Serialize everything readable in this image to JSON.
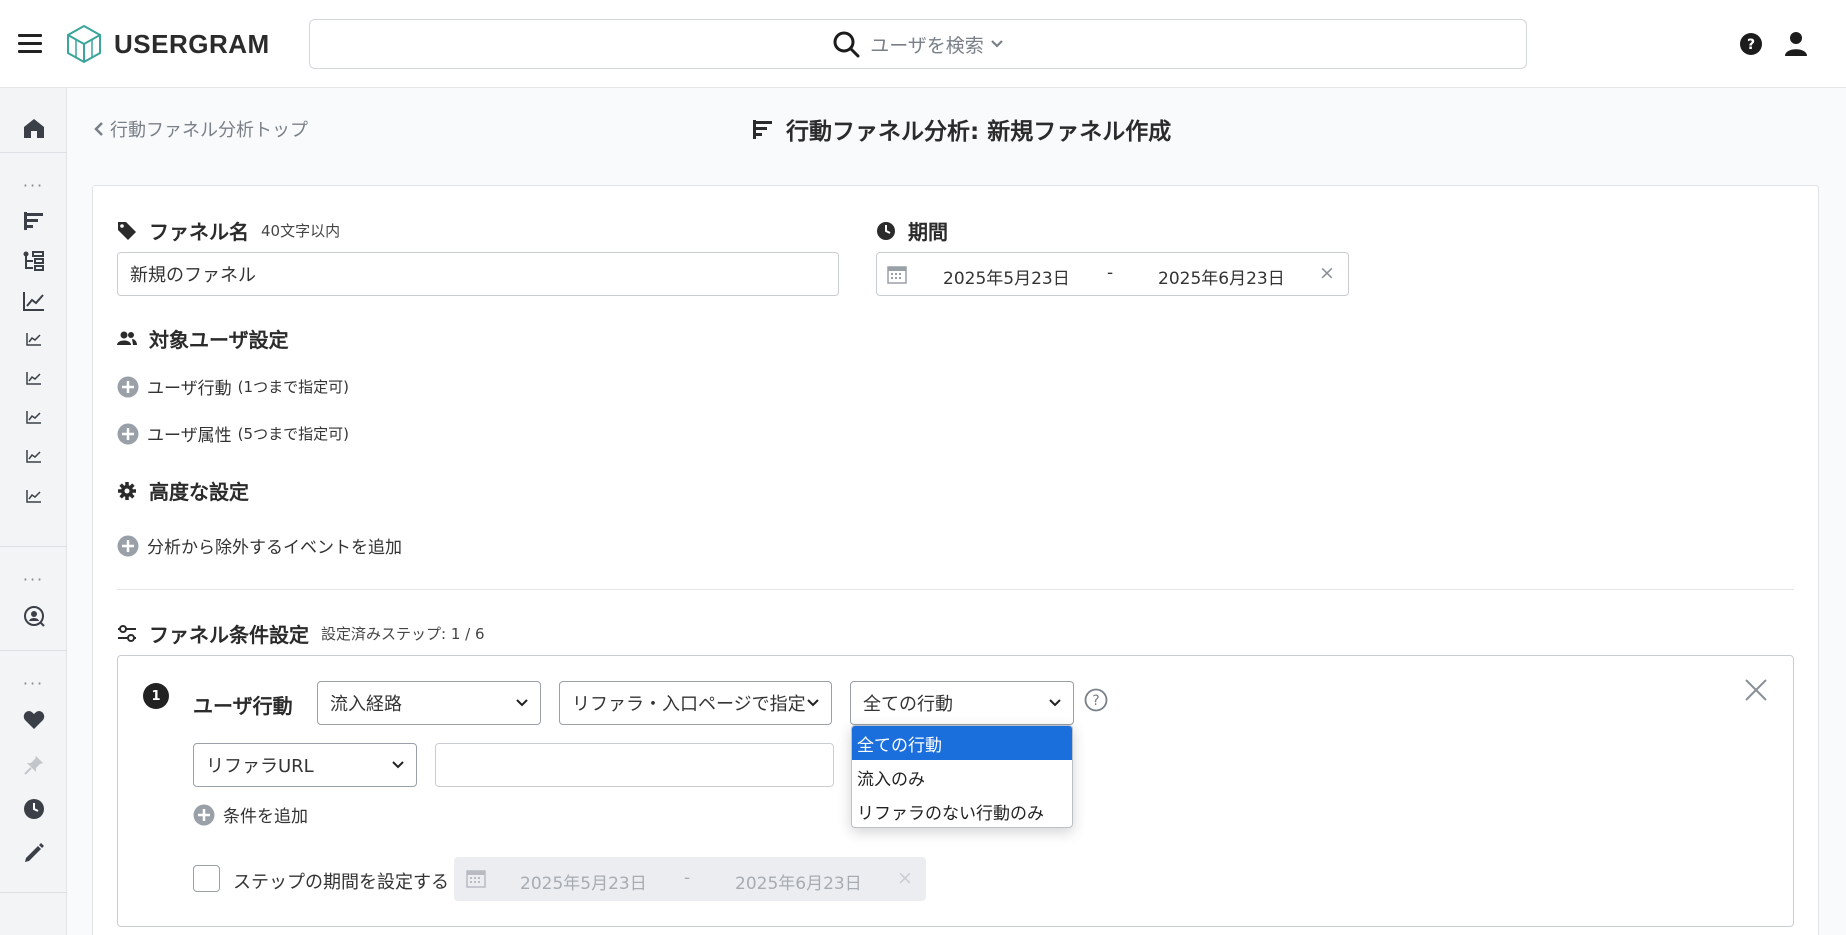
{
  "header": {
    "app_name": "USERGRAM",
    "search_placeholder": "ユーザを検索"
  },
  "breadcrumb": {
    "back_label": "行動ファネル分析トップ"
  },
  "page": {
    "title": "行動ファネル分析: 新規ファネル作成"
  },
  "funnel_name": {
    "label": "ファネル名",
    "hint": "40文字以内",
    "value": "新規のファネル"
  },
  "period": {
    "label": "期間",
    "start": "2025年5月23日",
    "separator": "-",
    "end": "2025年6月23日",
    "clear": "×"
  },
  "target_users": {
    "label": "対象ユーザ設定",
    "user_action_label": "ユーザ行動",
    "user_action_hint": "(1つまで指定可)",
    "user_attribute_label": "ユーザ属性",
    "user_attribute_hint": "(5つまで指定可)"
  },
  "advanced": {
    "label": "高度な設定",
    "exclude_event_label": "分析から除外するイベントを追加"
  },
  "funnel_conditions": {
    "label": "ファネル条件設定",
    "steps_hint": "設定済みステップ: 1 / 6"
  },
  "step1": {
    "number": "1",
    "label": "ユーザ行動",
    "type_select": "流入経路",
    "method_select": "リファラ・入口ページで指定",
    "action_select": "全ての行動",
    "action_options": [
      "全ての行動",
      "流入のみ",
      "リファラのない行動のみ"
    ],
    "url_select": "リファラURL",
    "url_value": "",
    "add_condition_label": "条件を追加",
    "period_checkbox_label": "ステップの期間を設定する",
    "period_start": "2025年5月23日",
    "period_separator": "-",
    "period_end": "2025年6月23日",
    "period_clear": "×"
  },
  "colors": {
    "accent": "#1a6fdc",
    "icon_gray": "#9aa0a8",
    "text_dark": "#2b2b2b"
  }
}
